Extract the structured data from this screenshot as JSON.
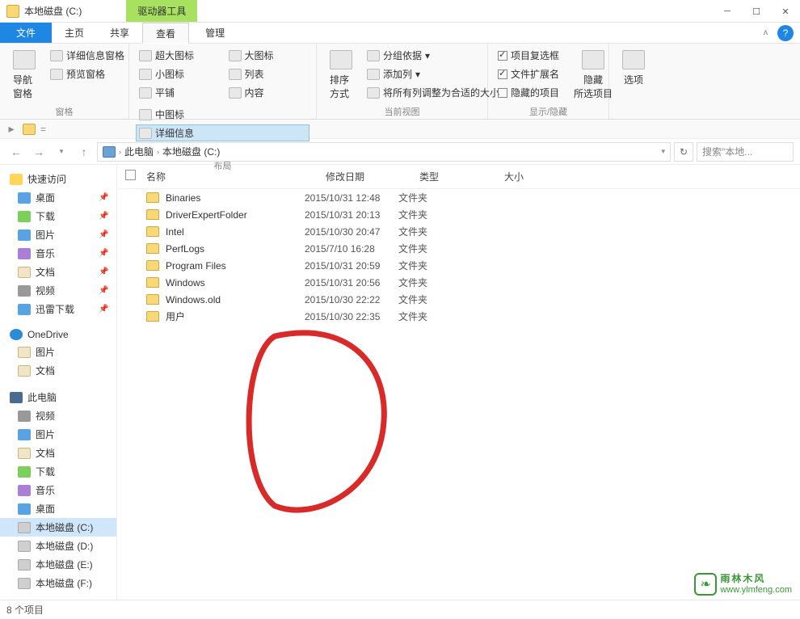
{
  "window": {
    "title": "本地磁盘 (C:)",
    "driveToolsTab": "驱动器工具"
  },
  "ribbonTabs": {
    "file": "文件",
    "home": "主页",
    "share": "共享",
    "view": "查看",
    "manage": "管理"
  },
  "ribbon": {
    "panes": {
      "navPane": "导航窗格",
      "preview": "预览窗格",
      "details": "详细信息窗格",
      "label": "窗格"
    },
    "layout": {
      "xlarge": "超大图标",
      "large": "大图标",
      "medium": "中图标",
      "small": "小图标",
      "list": "列表",
      "detail": "详细信息",
      "tiles": "平铺",
      "content": "内容",
      "label": "布局"
    },
    "currentView": {
      "sort": "排序方式",
      "groupBy": "分组依据",
      "addCols": "添加列",
      "fitCols": "将所有列调整为合适的大小",
      "label": "当前视图"
    },
    "showHide": {
      "itemCheck": "项目复选框",
      "ext": "文件扩展名",
      "hidden": "隐藏的项目",
      "hideSel": "隐藏\n所选项目",
      "label": "显示/隐藏"
    },
    "options": "选项"
  },
  "breadcrumb": {
    "thisPC": "此电脑",
    "drive": "本地磁盘 (C:)"
  },
  "search": {
    "placeholder": "搜索\"本地..."
  },
  "columns": {
    "name": "名称",
    "date": "修改日期",
    "type": "类型",
    "size": "大小"
  },
  "sidebar": {
    "quick": "快速访问",
    "quickItems": [
      {
        "label": "桌面",
        "cls": "blue"
      },
      {
        "label": "下载",
        "cls": "green"
      },
      {
        "label": "图片",
        "cls": "blue"
      },
      {
        "label": "音乐",
        "cls": "purple"
      },
      {
        "label": "文档",
        "cls": "doc"
      },
      {
        "label": "视频",
        "cls": "gray"
      },
      {
        "label": "迅雷下载",
        "cls": "blue"
      }
    ],
    "onedrive": "OneDrive",
    "odItems": [
      {
        "label": "图片",
        "cls": "doc"
      },
      {
        "label": "文档",
        "cls": "doc"
      }
    ],
    "thisPC": "此电脑",
    "pcItems": [
      {
        "label": "视频",
        "cls": "gray"
      },
      {
        "label": "图片",
        "cls": "blue"
      },
      {
        "label": "文档",
        "cls": "doc"
      },
      {
        "label": "下载",
        "cls": "green"
      },
      {
        "label": "音乐",
        "cls": "purple"
      },
      {
        "label": "桌面",
        "cls": "blue"
      },
      {
        "label": "本地磁盘 (C:)",
        "cls": "drive",
        "active": true
      },
      {
        "label": "本地磁盘 (D:)",
        "cls": "drive"
      },
      {
        "label": "本地磁盘 (E:)",
        "cls": "drive"
      },
      {
        "label": "本地磁盘 (F:)",
        "cls": "drive"
      }
    ]
  },
  "files": [
    {
      "name": "Binaries",
      "date": "2015/10/31 12:48",
      "type": "文件夹"
    },
    {
      "name": "DriverExpertFolder",
      "date": "2015/10/31 20:13",
      "type": "文件夹"
    },
    {
      "name": "Intel",
      "date": "2015/10/30 20:47",
      "type": "文件夹"
    },
    {
      "name": "PerfLogs",
      "date": "2015/7/10 16:28",
      "type": "文件夹"
    },
    {
      "name": "Program Files",
      "date": "2015/10/31 20:59",
      "type": "文件夹"
    },
    {
      "name": "Windows",
      "date": "2015/10/31 20:56",
      "type": "文件夹"
    },
    {
      "name": "Windows.old",
      "date": "2015/10/30 22:22",
      "type": "文件夹"
    },
    {
      "name": "用户",
      "date": "2015/10/30 22:35",
      "type": "文件夹"
    }
  ],
  "status": "8 个项目",
  "watermark": {
    "cn": "雨林木风",
    "url": "www.ylmfeng.com"
  }
}
